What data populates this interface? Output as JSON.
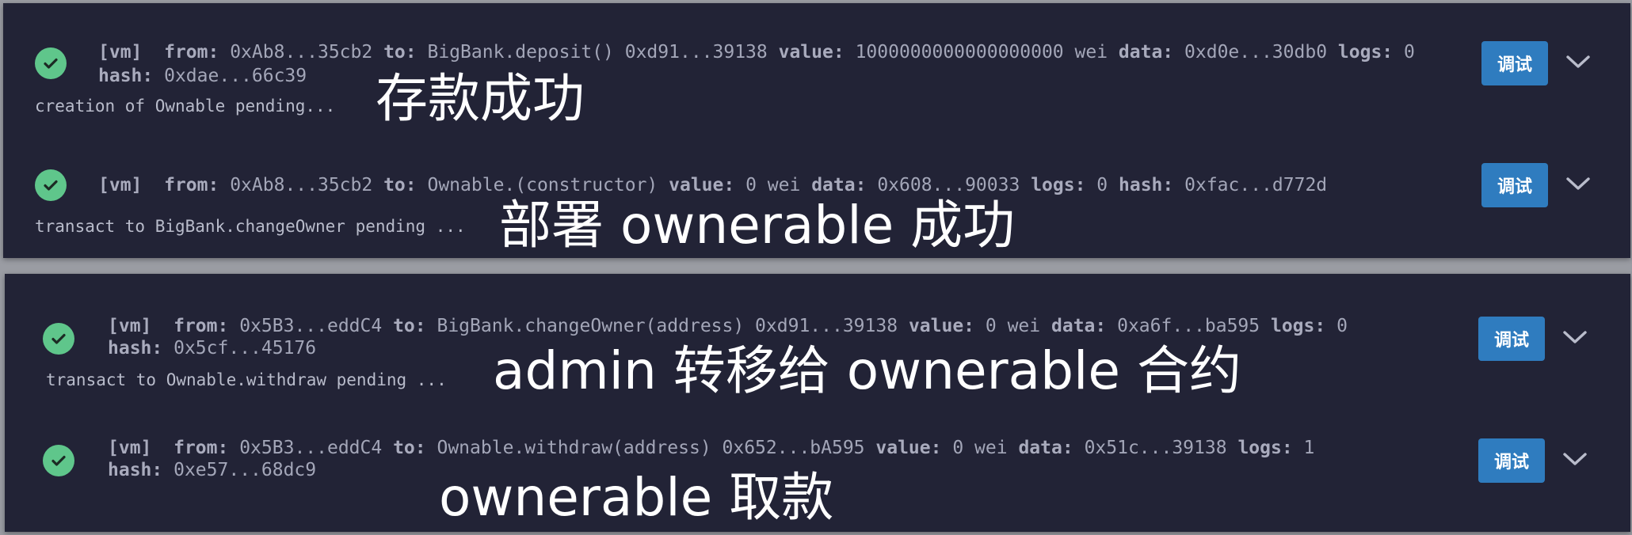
{
  "debug_label": "调试",
  "keys": {
    "from": "from:",
    "to": "to:",
    "value": "value:",
    "data": "data:",
    "logs": "logs:",
    "hash": "hash:"
  },
  "top_panel": {
    "entries": [
      {
        "tag": "[vm]",
        "from": "0xAb8...35cb2",
        "to": "BigBank.deposit() 0xd91...39138",
        "value": "1000000000000000000 wei",
        "data": "0xd0e...30db0",
        "logs": "0",
        "hash": "0xdae...66c39"
      },
      {
        "tag": "[vm]",
        "from": "0xAb8...35cb2",
        "to": "Ownable.(constructor)",
        "value": "0 wei",
        "data": "0x608...90033",
        "logs": "0",
        "hash": "0xfac...d772d"
      }
    ],
    "pending_1": "creation of Ownable pending...",
    "pending_2": "transact to BigBank.changeOwner pending ...",
    "caption_1": "存款成功",
    "caption_2": "部署 ownerable 成功"
  },
  "bottom_panel": {
    "entries": [
      {
        "tag": "[vm]",
        "from": "0x5B3...eddC4",
        "to": "BigBank.changeOwner(address) 0xd91...39138",
        "value": "0 wei",
        "data": "0xa6f...ba595",
        "logs": "0",
        "hash": "0x5cf...45176"
      },
      {
        "tag": "[vm]",
        "from": "0x5B3...eddC4",
        "to": "Ownable.withdraw(address) 0x652...bA595",
        "value": "0 wei",
        "data": "0x51c...39138",
        "logs": "1",
        "hash": "0xe57...68dc9"
      }
    ],
    "pending_1": "transact to Ownable.withdraw pending ...",
    "caption_1": "admin 转移给 ownerable 合约",
    "caption_2": "ownerable 取款"
  },
  "colors": {
    "panel": "#222336",
    "success": "#5fc68b",
    "button": "#2f7cbf",
    "text": "#a3a6b8"
  },
  "icons": [
    "check-circle-icon",
    "chevron-down-icon"
  ]
}
